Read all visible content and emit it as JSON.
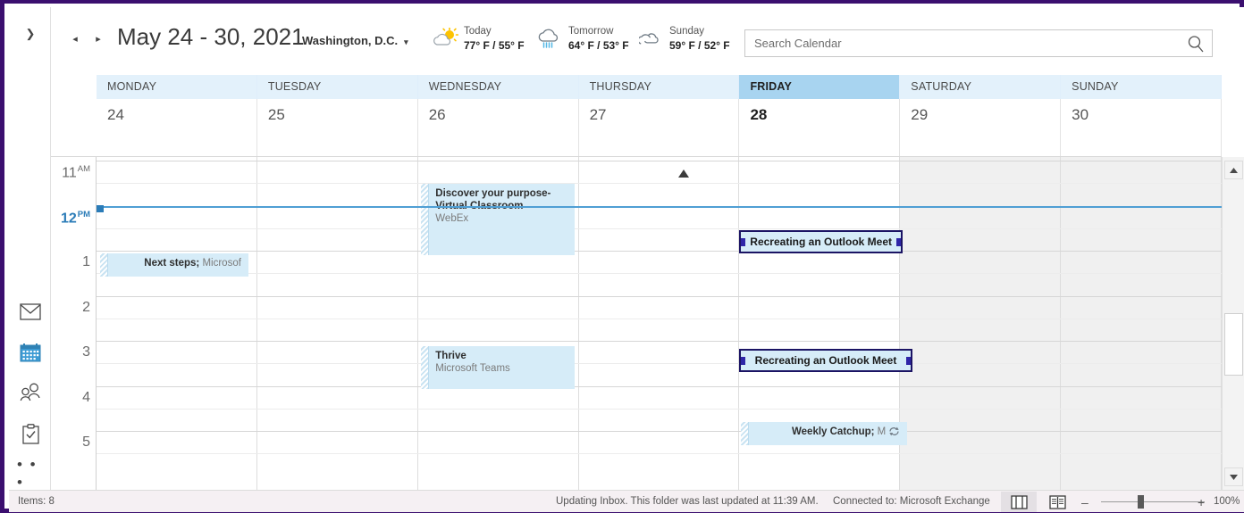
{
  "rail": {
    "expand_label": "❯",
    "items": [
      {
        "name": "mail",
        "label": "Mail"
      },
      {
        "name": "calendar",
        "label": "Calendar"
      },
      {
        "name": "people",
        "label": "People"
      },
      {
        "name": "tasks",
        "label": "Tasks"
      },
      {
        "name": "more",
        "label": "• • •"
      }
    ]
  },
  "topbar": {
    "prev_label": "◂",
    "next_label": "▸",
    "date_range": "May 24 - 30, 2021",
    "location": "Washington,  D.C.",
    "location_caret": "▾",
    "weather": [
      {
        "day": "Today",
        "temp": "77° F / 55° F",
        "icon": "sun-behind-cloud-icon"
      },
      {
        "day": "Tomorrow",
        "temp": "64° F / 53° F",
        "icon": "rain-cloud-icon"
      },
      {
        "day": "Sunday",
        "temp": "59° F / 52° F",
        "icon": "cloudy-icon"
      }
    ],
    "search_placeholder": "Search Calendar",
    "search_value": ""
  },
  "calendar": {
    "days": [
      {
        "weekday": "MONDAY",
        "date": "24",
        "today": false,
        "weekend": false
      },
      {
        "weekday": "TUESDAY",
        "date": "25",
        "today": false,
        "weekend": false
      },
      {
        "weekday": "WEDNESDAY",
        "date": "26",
        "today": false,
        "weekend": false
      },
      {
        "weekday": "THURSDAY",
        "date": "27",
        "today": false,
        "weekend": false
      },
      {
        "weekday": "FRIDAY",
        "date": "28",
        "today": true,
        "weekend": false
      },
      {
        "weekday": "SATURDAY",
        "date": "29",
        "today": false,
        "weekend": true
      },
      {
        "weekday": "SUNDAY",
        "date": "30",
        "today": false,
        "weekend": true
      }
    ],
    "time_labels": [
      {
        "hour": "11",
        "meridiem": "AM",
        "current": false
      },
      {
        "hour": "12",
        "meridiem": "PM",
        "current": true
      },
      {
        "hour": "1",
        "meridiem": "",
        "current": false
      },
      {
        "hour": "2",
        "meridiem": "",
        "current": false
      },
      {
        "hour": "3",
        "meridiem": "",
        "current": false
      },
      {
        "hour": "4",
        "meridiem": "",
        "current": false
      },
      {
        "hour": "5",
        "meridiem": "",
        "current": false
      }
    ],
    "appointments": [
      {
        "id": "discover-purpose",
        "title": "Discover your purpose-",
        "title2": "Virtual Classroom",
        "subtitle": "WebEx",
        "day": 2,
        "selected": false,
        "align": "left"
      },
      {
        "id": "next-steps",
        "title": "Next steps;",
        "subtitle": " Microsof",
        "day": 0,
        "selected": false,
        "align": "right"
      },
      {
        "id": "thrive",
        "title": "Thrive",
        "subtitle": "Microsoft Teams",
        "day": 2,
        "selected": false,
        "align": "left"
      },
      {
        "id": "recreating-outlook-meet-1",
        "title": "Recreating an Outlook Meet",
        "day": 4,
        "selected": true
      },
      {
        "id": "recreating-outlook-meet-2",
        "title": "Recreating an Outlook Meet",
        "day": 4,
        "selected": true
      },
      {
        "id": "weekly-catchup",
        "title": "Weekly Catchup;",
        "subtitle": " M",
        "day": 4,
        "selected": false,
        "align": "right",
        "recurring": true
      }
    ]
  },
  "statusbar": {
    "items": "Items: 8",
    "updating": "Updating Inbox.  This folder was last updated at 11:39 AM.",
    "connected": "Connected to: Microsoft Exchange",
    "view_normal": "Normal view",
    "view_reading": "Reading view",
    "zoom_minus": "–",
    "zoom_plus": "+",
    "zoom_level": "100%"
  },
  "colors": {
    "accent": "#1b1464",
    "today_header": "#a8d4f0",
    "header_band": "#e3f1fb",
    "appointment": "#d6ecf8",
    "current_time": "#4f9fd4",
    "window_frame": "#3b0f6f"
  }
}
